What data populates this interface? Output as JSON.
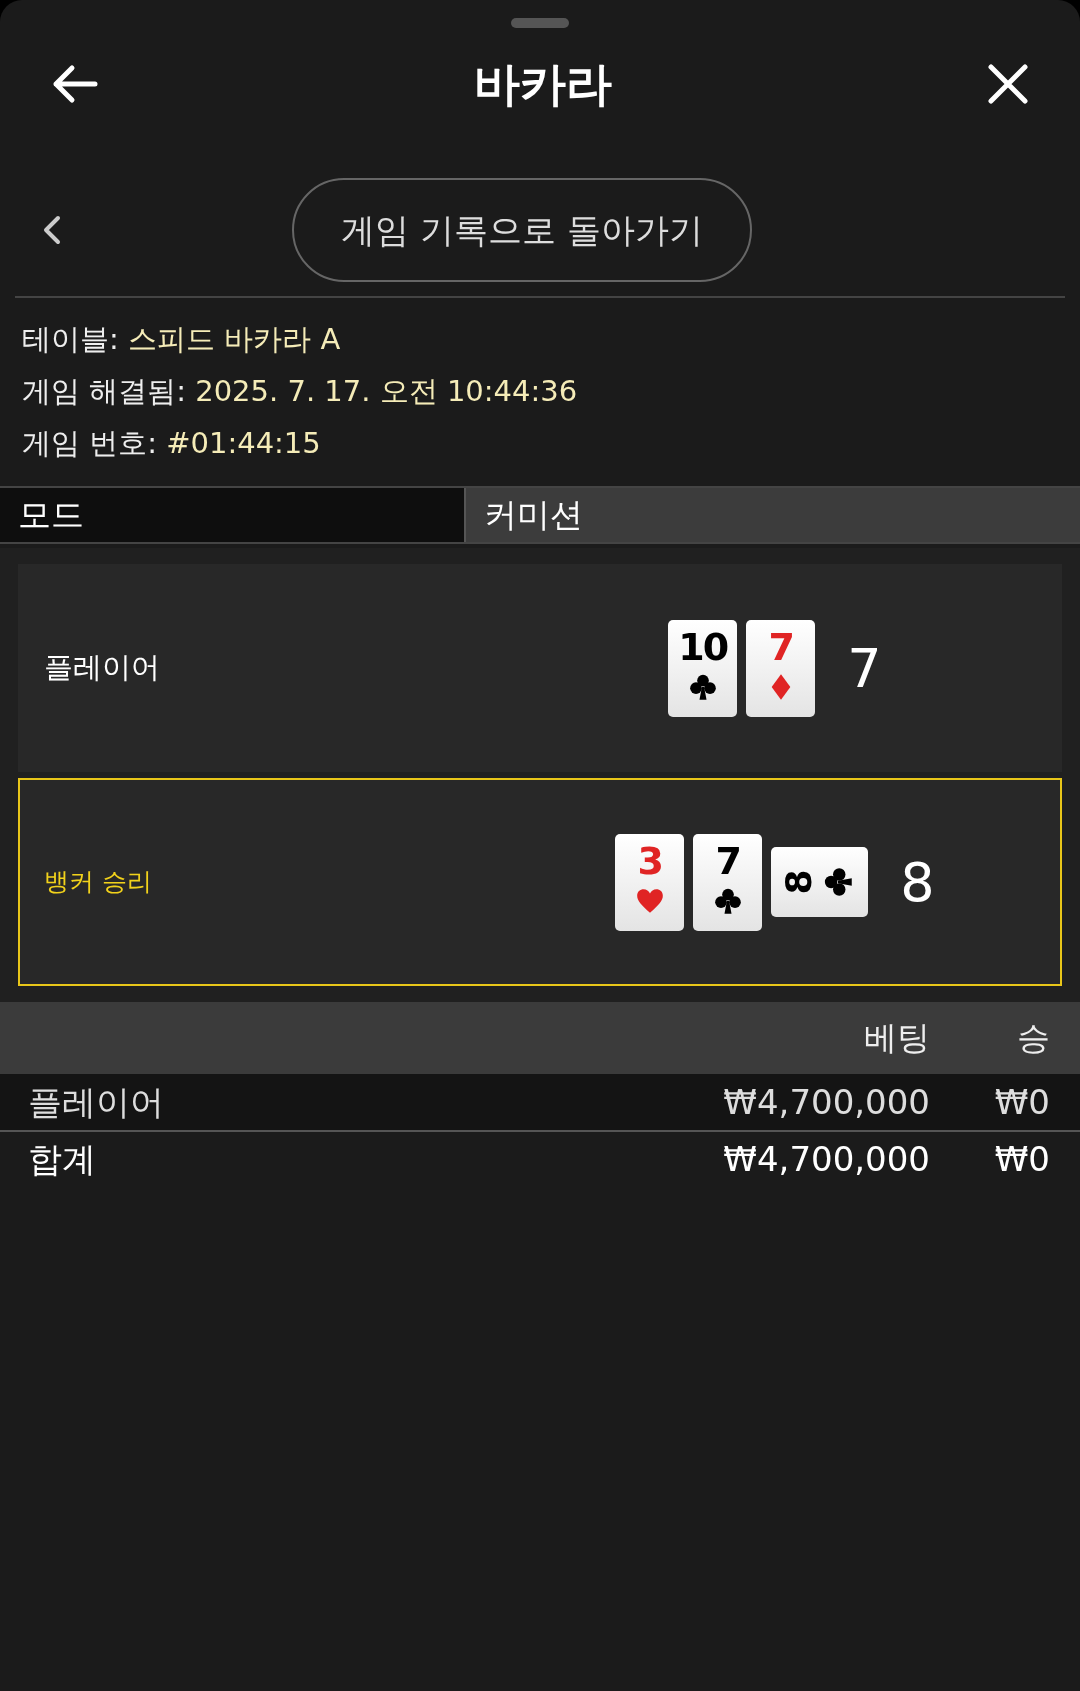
{
  "header": {
    "title": "바카라"
  },
  "back_link": {
    "label": "게임 기록으로 돌아가기"
  },
  "info": [
    {
      "label": "테이블:",
      "value": "스피드 바카라 A"
    },
    {
      "label": "게임 해결됨:",
      "value": "2025. 7. 17. 오전 10:44:36"
    },
    {
      "label": "게임 번호:",
      "value": "#01:44:15"
    }
  ],
  "mode": {
    "label": "모드",
    "value": "커미션"
  },
  "hands": [
    {
      "label": "플레이어",
      "winner": false,
      "score": "7",
      "cards": [
        {
          "rank": "10",
          "kind": "club",
          "sideways": false
        },
        {
          "rank": "7",
          "kind": "diamond",
          "sideways": false
        }
      ]
    },
    {
      "label": "뱅커 승리",
      "winner": true,
      "score": "8",
      "cards": [
        {
          "rank": "3",
          "kind": "heart",
          "sideways": false
        },
        {
          "rank": "7",
          "kind": "club",
          "sideways": false
        },
        {
          "rank": "8",
          "kind": "club",
          "sideways": true
        }
      ]
    }
  ],
  "bets": {
    "columns": [
      "베팅",
      "승"
    ],
    "rows": [
      {
        "kind": "bet",
        "label": "플레이어",
        "bet": "₩4,700,000",
        "win": "₩0"
      },
      {
        "kind": "total",
        "label": "합계",
        "bet": "₩4,700,000",
        "win": "₩0"
      }
    ]
  }
}
